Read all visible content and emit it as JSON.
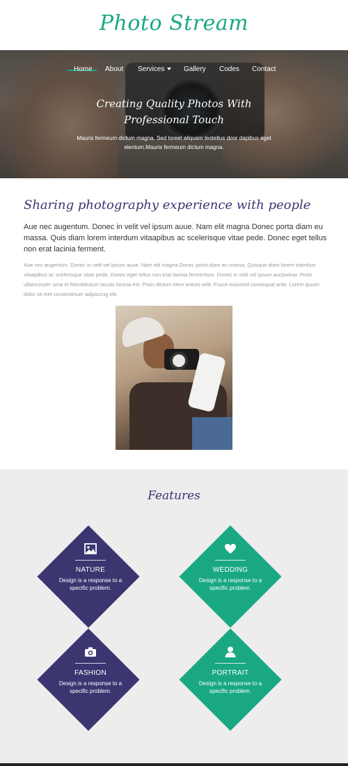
{
  "brand": {
    "logo": "Photo Stream"
  },
  "nav": {
    "items": [
      {
        "label": "Home"
      },
      {
        "label": "About"
      },
      {
        "label": "Services"
      },
      {
        "label": "Gallery"
      },
      {
        "label": "Codes"
      },
      {
        "label": "Contact"
      }
    ]
  },
  "hero": {
    "title_line1": "Creating Quality Photos With",
    "title_line2": "Professional Touch",
    "text": "Mauris fermeum dictum magna. Sed loreet aliquam leotellus door dapibus eget elentum.Mauris fermeum dictum magna."
  },
  "about": {
    "title": "Sharing photography experience with people",
    "lead": "Aue nec augentum. Donec in velit vel ipsum auue. Nam elit magna Donec porta diam eu massa. Quis diam lorem interdum vitaapibus ac scelerisque vitae pede. Donec eget tellus non erat lacinia ferment.",
    "body": "Aue nec augentum. Donec in velit vel ipsum auue. Nam elit magna Donec porta diam eu massa. Quisque diam lorem interdum vitaapibus ac scelerisque vitae pede. Donec eget tellus non erat lacinia fermentum. Donec in velit vel ipsum auctovinar. Proin ullamcorper urna et felisstibulum iaculis lacinia est. Proin dictum elem entum velit. Fusce euismod consequat ante. Lorem ipsum dolor sit met consectetuer adipiscing elit."
  },
  "features": {
    "title": "Features",
    "items": [
      {
        "name": "NATURE",
        "desc": "Design is a response to a specific problem.",
        "icon": "image-icon",
        "color": "#3b3570"
      },
      {
        "name": "WEDDING",
        "desc": "Design is a response to a specific problem.",
        "icon": "heart-icon",
        "color": "#1aa882"
      },
      {
        "name": "FASHION",
        "desc": "Design is a response to a specific problem.",
        "icon": "camera-icon",
        "color": "#3b3570"
      },
      {
        "name": "PORTRAIT",
        "desc": "Design is a response to a specific problem.",
        "icon": "user-icon",
        "color": "#1aa882"
      }
    ]
  },
  "colors": {
    "accent_green": "#1aa882",
    "accent_purple": "#3b3570"
  }
}
